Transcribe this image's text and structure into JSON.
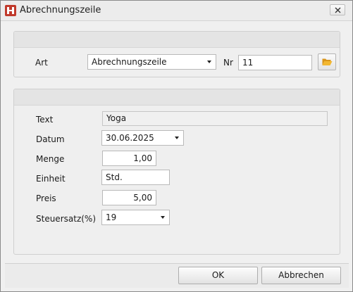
{
  "window": {
    "title": "Abrechnungszeile"
  },
  "header_panel": {
    "art_label": "Art",
    "art_value": "Abrechnungszeile",
    "nr_label": "Nr",
    "nr_value": "11"
  },
  "detail_panel": {
    "text_label": "Text",
    "text_value": "Yoga",
    "datum_label": "Datum",
    "datum_value": "30.06.2025",
    "menge_label": "Menge",
    "menge_value": "1,00",
    "einheit_label": "Einheit",
    "einheit_value": "Std.",
    "preis_label": "Preis",
    "preis_value": "5,00",
    "steuersatz_label": "Steuersatz(%)",
    "steuersatz_value": "19"
  },
  "footer": {
    "ok_label": "OK",
    "cancel_label": "Abbrechen"
  },
  "icons": {
    "app": "app-logo-icon",
    "close": "close-icon",
    "folder": "folder-open-icon",
    "dropdown": "chevron-down-icon"
  },
  "colors": {
    "app_icon": "#c0392b",
    "folder_icon": "#e8a317"
  }
}
